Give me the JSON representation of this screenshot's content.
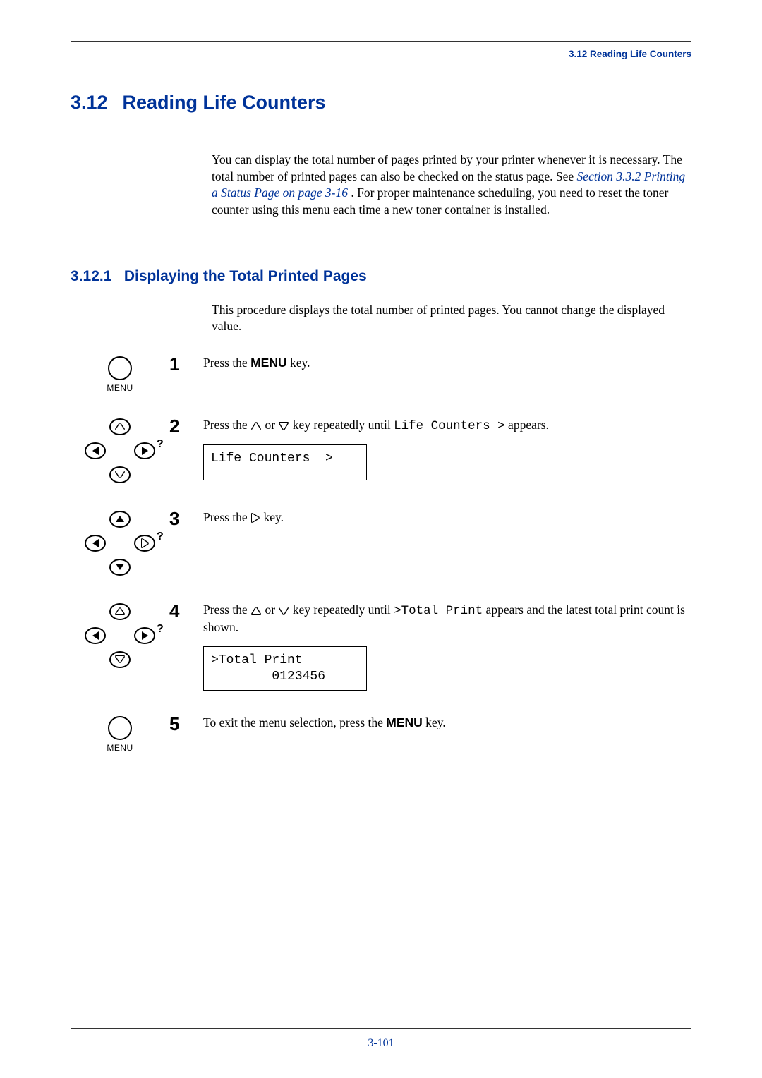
{
  "running_head": "3.12 Reading Life Counters",
  "section": {
    "number": "3.12",
    "title": "Reading Life Counters"
  },
  "intro": {
    "part1": "You can display the total number of pages printed by your printer whenever it is necessary. The total number of printed pages can also be checked on the status page. See ",
    "link": "Section 3.3.2 Printing a Status Page on page 3-16",
    "part2": " . For proper maintenance scheduling, you need to reset the toner counter using this menu each time a new toner container is installed."
  },
  "subsection": {
    "number": "3.12.1",
    "title": "Displaying the Total Printed Pages",
    "intro": "This procedure displays the total number of printed pages. You cannot change the displayed value."
  },
  "menu_label": "MENU",
  "steps": {
    "s1": {
      "n": "1",
      "a": "Press the ",
      "menu": "MENU",
      "b": " key."
    },
    "s2": {
      "n": "2",
      "a": "Press the ",
      "b": " or ",
      "c": " key repeatedly until ",
      "mono": "Life Counters  >",
      "d": " appears.",
      "lcd": "Life Counters  >"
    },
    "s3": {
      "n": "3",
      "a": "Press the ",
      "b": " key."
    },
    "s4": {
      "n": "4",
      "a": "Press the ",
      "b": " or ",
      "c": " key repeatedly until ",
      "mono": ">Total Print",
      "d": " appears and the latest total print count is shown.",
      "lcd": ">Total Print\n        0123456"
    },
    "s5": {
      "n": "5",
      "a": "To exit the menu selection, press the ",
      "menu": "MENU",
      "b": " key."
    }
  },
  "page_number": "3-101"
}
